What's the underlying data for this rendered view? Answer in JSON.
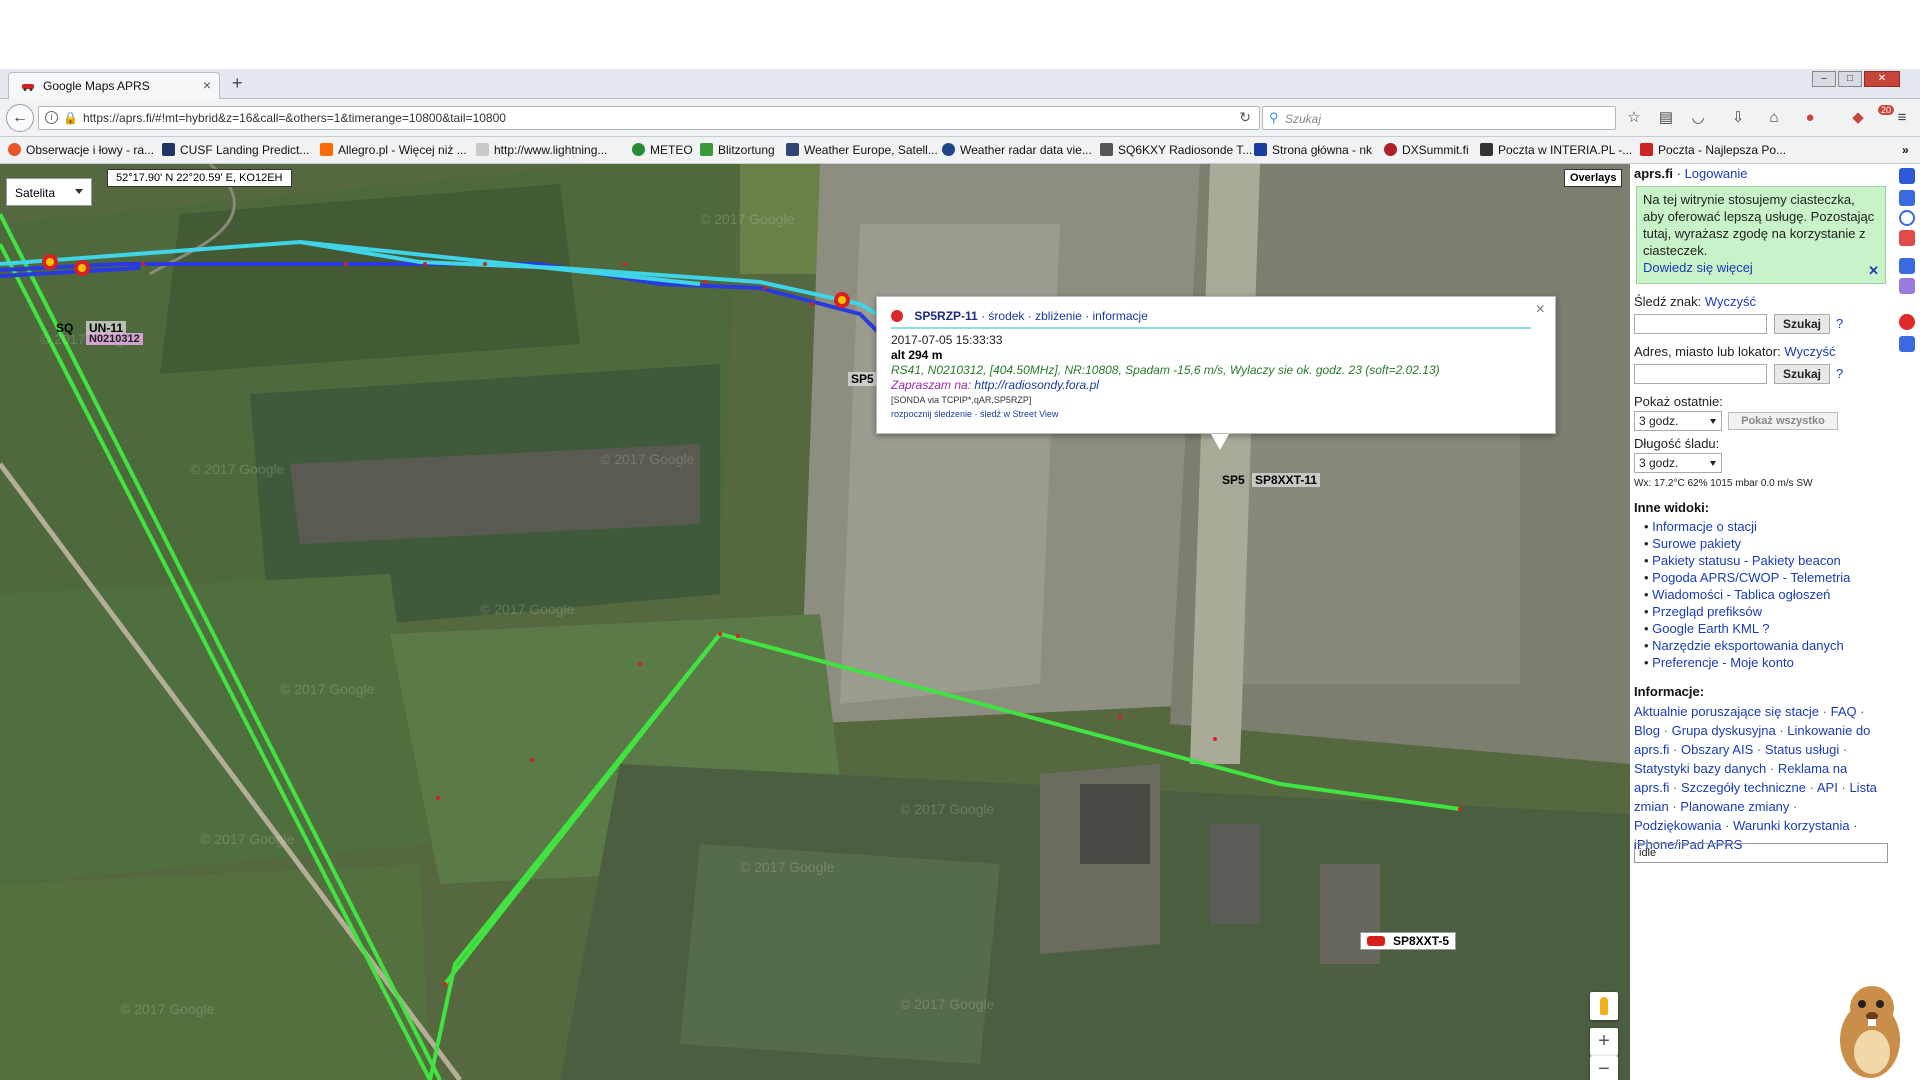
{
  "browser": {
    "tab_title": "Google Maps APRS",
    "tab_close": "×",
    "new_tab": "+",
    "url": "https://aprs.fi/#!mt=hybrid&z=16&call=&others=1&timerange=10800&tail=10800",
    "search_placeholder": "Szukaj",
    "badge": "20",
    "bookmarks": [
      {
        "label": "Obserwacje i łowy - ra...",
        "color": "#e8552a"
      },
      {
        "label": "CUSF Landing Predict...",
        "color": "#223366"
      },
      {
        "label": "Allegro.pl - Więcej niż ...",
        "color": "#ff6a00"
      },
      {
        "label": "http://www.lightning...",
        "color": "#c9c9c9"
      },
      {
        "label": "METEO",
        "color": "#2a8a3a"
      },
      {
        "label": "Blitzortung",
        "color": "#3a9a3a"
      },
      {
        "label": "Weather Europe, Satell...",
        "color": "#334477"
      },
      {
        "label": "Weather radar data vie...",
        "color": "#224488"
      },
      {
        "label": "SQ6KXY Radiosonde T...",
        "color": "#555555"
      },
      {
        "label": "Strona główna - nk",
        "color": "#1a3c9e"
      },
      {
        "label": "DXSummit.fi",
        "color": "#aa2222"
      },
      {
        "label": "Poczta w INTERIA.PL -...",
        "color": "#333333"
      },
      {
        "label": "Poczta - Najlepsza Po...",
        "color": "#cc2222"
      }
    ],
    "bookmark_prefix": [
      "",
      "",
      "",
      "",
      "",
      "",
      "",
      "",
      "",
      "nk",
      "",
      "int",
      "WP"
    ],
    "more": "»"
  },
  "map": {
    "map_type": "Satelita",
    "coords": "52°17.90' N 22°20.59' E, KO12EH",
    "overlays": "Overlays",
    "labels": {
      "sq_un": "UN-11",
      "sq_prefix": "SQ",
      "n0210312": "N0210312",
      "sp5_left": "SP5",
      "sp5_small": "SP5",
      "sp8xxt_11": "SP8XXT-11",
      "sp8xxt_5": "SP8XXT-5"
    },
    "zoom_in": "+",
    "zoom_out": "−",
    "watermark": "© 2017 Google",
    "colors": {
      "track_light": "#3fd4e8",
      "track_dark": "#2a3adf",
      "track_green": "#41e341",
      "waypoint": "#d82020"
    }
  },
  "popup": {
    "callsign": "SP5RZP-11",
    "links": [
      "środek",
      "zbliżenie",
      "informacje"
    ],
    "timestamp": "2017-07-05 15:33:33",
    "altitude": "alt 294 m",
    "comment": "RS41, N0210312, [404.50MHz], NR:10808, Spadam -15,6 m/s, Wylaczy sie ok. godz. 23 (soft=2.02.13)",
    "invite_label": "Zapraszam na:",
    "invite_url": "http://radiosondy.fora.pl",
    "path": "[SONDA via TCPIP*,qAR,SP5RZP]",
    "actions": "rozpocznij śledzenie · śledź w Street View",
    "close": "×"
  },
  "sidebar": {
    "site": "aprs.fi",
    "login": "Logowanie",
    "cookie_text": "Na tej witrynie stosujemy ciasteczka, aby oferować lepszą usługę. Pozostając tutaj, wyrażasz zgodę na korzystanie z ciasteczek.",
    "cookie_more": "Dowiedz się więcej",
    "cookie_close": "✕",
    "track_label": "Śledź znak:",
    "clear": "Wyczyść",
    "search_btn": "Szukaj",
    "help": "?",
    "address_label": "Adres, miasto lub lokator:",
    "show_last_label": "Pokaż ostatnie:",
    "show_last_value": "3 godz.",
    "show_all_btn": "Pokaż wszystko",
    "tail_label": "Długość śladu:",
    "tail_value": "3 godz.",
    "wx": "Wx: 17.2°C 62% 1015 mbar 0.0 m/s SW",
    "other_views_heading": "Inne widoki:",
    "other_views": [
      "Informacje o stacji",
      "Surowe pakiety",
      "Pakiety statusu - Pakiety beacon",
      "Pogoda APRS/CWOP - Telemetria",
      "Wiadomości - Tablica ogłoszeń",
      "Przegląd prefiksów",
      "Google Earth KML ?",
      "Narzędzie eksportowania danych",
      "Preferencje - Moje konto"
    ],
    "info_heading": "Informacje:",
    "info_links": [
      "Aktualnie poruszające się stacje",
      "FAQ",
      "Blog",
      "Grupa dyskusyjna",
      "Linkowanie do aprs.fi",
      "Obszary AIS",
      "Status usługi",
      "Statystyki bazy danych",
      "Reklama na aprs.fi",
      "Szczegóły techniczne",
      "API",
      "Lista zmian",
      "Planowane zmiany",
      "Podziękowania",
      "Warunki korzystania",
      "iPhone/iPad APRS"
    ],
    "status": "idle"
  }
}
